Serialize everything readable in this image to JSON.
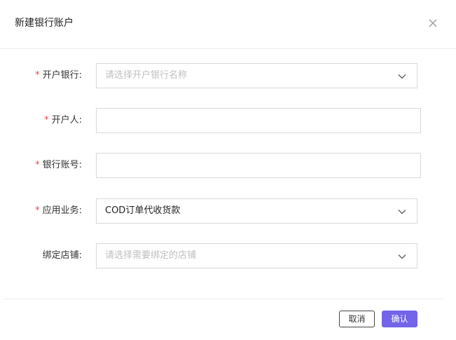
{
  "dialog": {
    "title": "新建银行账户"
  },
  "form": {
    "required_mark": "*",
    "bank": {
      "label": "开户银行:",
      "placeholder": "请选择开户银行名称"
    },
    "holder": {
      "label": "开户人:",
      "value": ""
    },
    "account_no": {
      "label": "银行账号:",
      "value": ""
    },
    "business": {
      "label": "应用业务:",
      "value": "COD订单代收货款"
    },
    "store": {
      "label": "绑定店铺:",
      "placeholder": "请选择需要绑定的店铺"
    }
  },
  "footer": {
    "cancel_label": "取消",
    "confirm_label": "确认"
  },
  "colors": {
    "primary": "#7364e8",
    "required": "#e5484d",
    "border": "#d9d9d9",
    "placeholder": "#bfbfbf"
  },
  "icons": {
    "close": "close-icon",
    "dropdown": "chevron-down-icon"
  }
}
